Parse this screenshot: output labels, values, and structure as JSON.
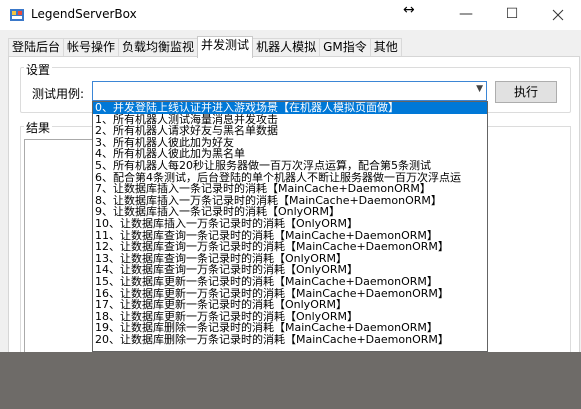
{
  "window": {
    "title": "LegendServerBox",
    "resize_glyph": "↔",
    "minimize_glyph": "—",
    "maximize_glyph": "☐"
  },
  "tabs": [
    {
      "label": "登陆后台"
    },
    {
      "label": "帐号操作"
    },
    {
      "label": "负载均衡监视"
    },
    {
      "label": "并发测试",
      "active": true
    },
    {
      "label": "机器人模拟"
    },
    {
      "label": "GM指令"
    },
    {
      "label": "其他"
    }
  ],
  "settings": {
    "legend": "设置",
    "case_label": "测试用例:",
    "selected_value": "",
    "execute_label": "执行"
  },
  "result": {
    "legend": "结果"
  },
  "dropdown": {
    "items": [
      "0、并发登陆上线认证并进入游戏场景【在机器人模拟页面做】",
      "1、所有机器人测试海量消息并发攻击",
      "2、所有机器人请求好友与黑名单数据",
      "3、所有机器人彼此加为好友",
      "4、所有机器人彼此加为黑名单",
      "5、所有机器人每20秒让服务器做一百万次浮点运算，配合第5条测试",
      "6、配合第4条测试，后台登陆的单个机器人不断让服务器做一百万次浮点运",
      "7、让数据库插入一条记录时的消耗【MainCache+DaemonORM】",
      "8、让数据库插入一万条记录时的消耗【MainCache+DaemonORM】",
      "9、让数据库插入一条记录时的消耗【OnlyORM】",
      "10、让数据库插入一万条记录时的消耗【OnlyORM】",
      "11、让数据库查询一条记录时的消耗【MainCache+DaemonORM】",
      "12、让数据库查询一万条记录时的消耗【MainCache+DaemonORM】",
      "13、让数据库查询一条记录时的消耗【OnlyORM】",
      "14、让数据库查询一万条记录时的消耗【OnlyORM】",
      "15、让数据库更新一条记录时的消耗【MainCache+DaemonORM】",
      "16、让数据库更新一万条记录时的消耗【MainCache+DaemonORM】",
      "17、让数据库更新一条记录时的消耗【OnlyORM】",
      "18、让数据库更新一万条记录时的消耗【OnlyORM】",
      "19、让数据库删除一条记录时的消耗【MainCache+DaemonORM】",
      "20、让数据库删除一万条记录时的消耗【MainCache+DaemonORM】"
    ],
    "selected_index": 0
  },
  "colors": {
    "selection": "#0078d7",
    "focus_border": "#3b86d6",
    "backdrop": "#6e6b68"
  }
}
